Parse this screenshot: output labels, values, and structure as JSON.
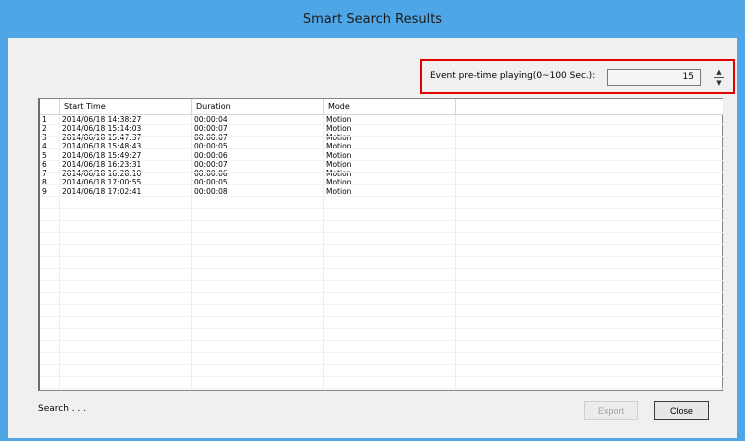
{
  "window": {
    "title": "Smart Search Results"
  },
  "pretime": {
    "label": "Event pre-time playing(0~100 Sec.):",
    "value": "15"
  },
  "table": {
    "columns": [
      "",
      "Start Time",
      "Duration",
      "Mode"
    ],
    "rows": [
      [
        "1",
        "2014/06/18 14:38:27",
        "00:00:04",
        "Motion"
      ],
      [
        "2",
        "2014/06/18 15:14:03",
        "00:00:07",
        "Motion"
      ],
      [
        "3",
        "2014/06/18 15:47:37",
        "00:00:07",
        "Motion"
      ],
      [
        "4",
        "2014/06/18 15:48:43",
        "00:00:05",
        "Motion"
      ],
      [
        "5",
        "2014/06/18 15:49:27",
        "00:00:06",
        "Motion"
      ],
      [
        "6",
        "2014/06/18 16:23:31",
        "00:00:07",
        "Motion"
      ],
      [
        "7",
        "2014/06/18 16:28:10",
        "00:00:06",
        "Motion"
      ],
      [
        "8",
        "2014/06/18 17:00:55",
        "00:00:05",
        "Motion"
      ],
      [
        "9",
        "2014/06/18 17:02:41",
        "00:00:08",
        "Motion"
      ]
    ]
  },
  "status": {
    "text": "Search . . ."
  },
  "buttons": {
    "export": "Export",
    "close": "Close"
  },
  "colors": {
    "titlebar": "#4fa6e6",
    "highlight": "#e00000"
  }
}
